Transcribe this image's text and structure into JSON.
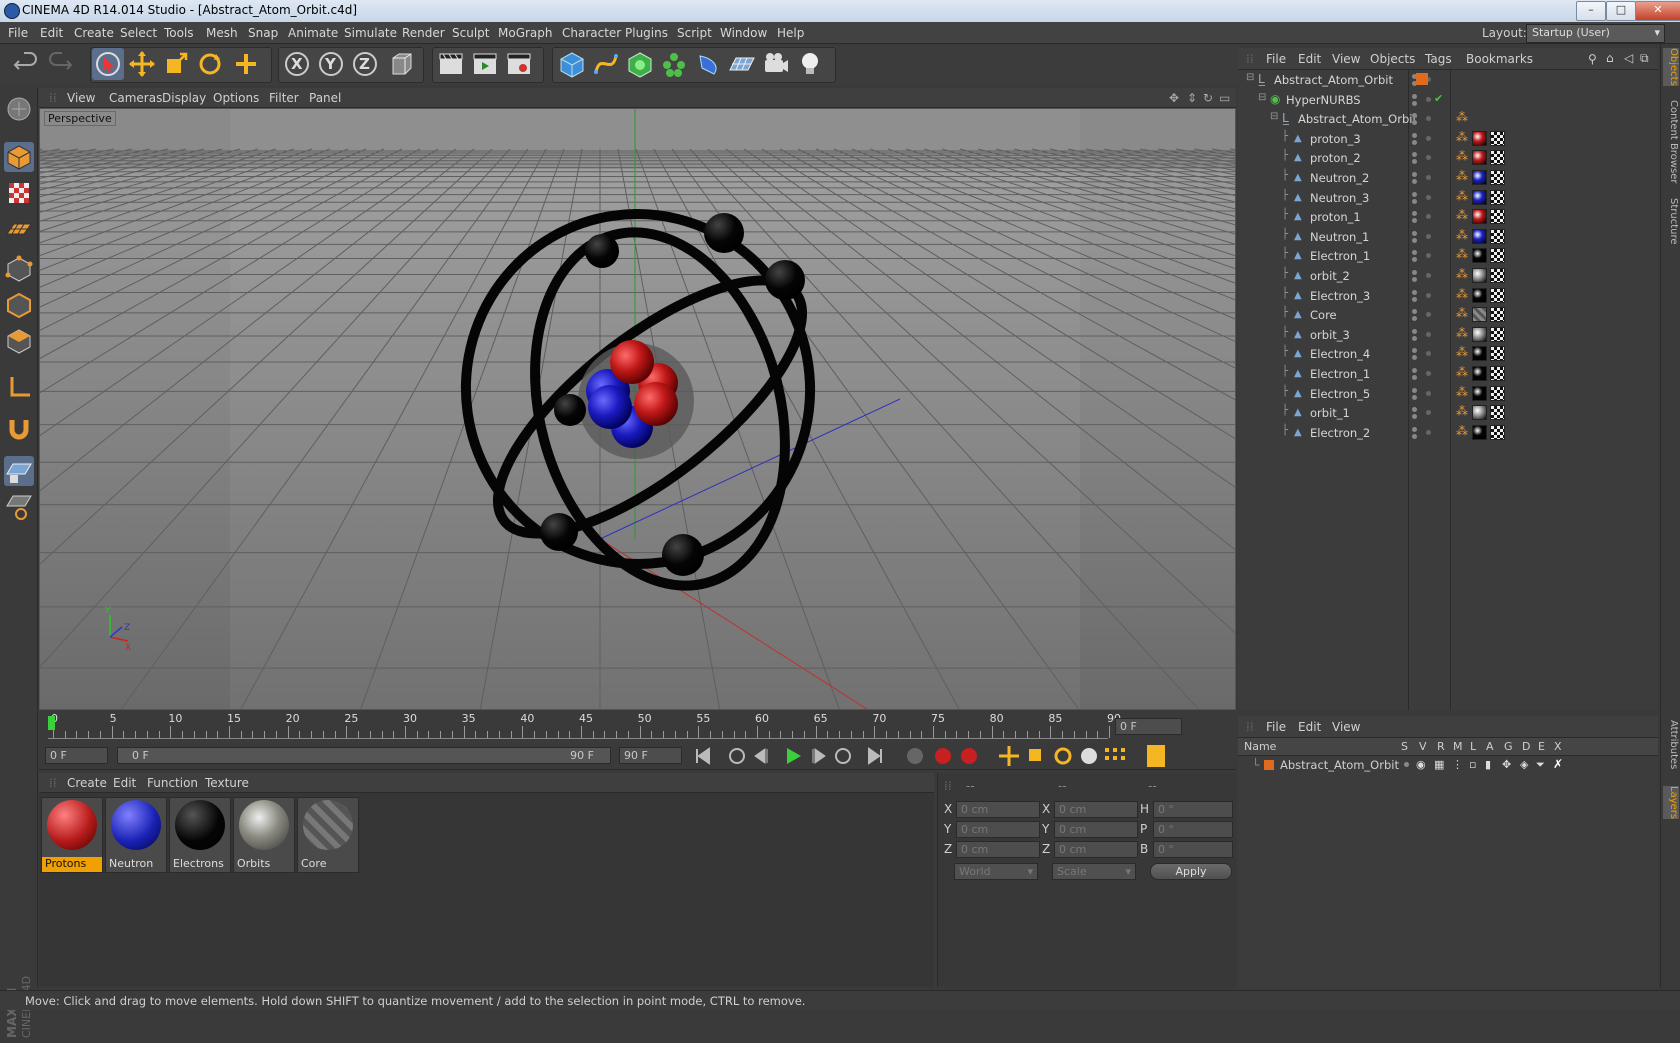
{
  "window": {
    "title": "CINEMA 4D R14.014 Studio - [Abstract_Atom_Orbit.c4d]",
    "min": "–",
    "max": "□",
    "close": "✕"
  },
  "menubar": {
    "items": [
      "File",
      "Edit",
      "Create",
      "Select",
      "Tools",
      "Mesh",
      "Snap",
      "Animate",
      "Simulate",
      "Render",
      "Sculpt",
      "MoGraph",
      "Character",
      "Plugins",
      "Script",
      "Window",
      "Help"
    ],
    "layout_label": "Layout:",
    "layout_value": "Startup (User)"
  },
  "viewport": {
    "menu": [
      "View",
      "Cameras",
      "Display",
      "Options",
      "Filter",
      "Panel"
    ],
    "label": "Perspective",
    "axis_y": "Y",
    "axis_x": "X",
    "axis_z": "Z"
  },
  "timeline": {
    "ticks": [
      "0",
      "5",
      "10",
      "15",
      "20",
      "25",
      "30",
      "35",
      "40",
      "45",
      "50",
      "55",
      "60",
      "65",
      "70",
      "75",
      "80",
      "85",
      "90"
    ],
    "current_frame": "0 F",
    "start_field": "0 F",
    "range_start": "0 F",
    "range_end": "90 F",
    "end_field": "90 F"
  },
  "materials": {
    "menu": [
      "Create",
      "Edit",
      "Function",
      "Texture"
    ],
    "items": [
      {
        "name": "Protons",
        "color": "#b51a1a",
        "selected": true
      },
      {
        "name": "Neutron",
        "color": "#1a22b5",
        "selected": false
      },
      {
        "name": "Electrons",
        "color": "#050505",
        "selected": false
      },
      {
        "name": "Orbits",
        "color": "#8a8a80",
        "selected": false
      },
      {
        "name": "Core",
        "color": "#6a6a6a",
        "selected": false
      }
    ]
  },
  "coords": {
    "headers": [
      "--",
      "--",
      "--"
    ],
    "rows": [
      {
        "a": "X",
        "av": "0 cm",
        "b": "X",
        "bv": "0 cm",
        "c": "H",
        "cv": "0 °"
      },
      {
        "a": "Y",
        "av": "0 cm",
        "b": "Y",
        "bv": "0 cm",
        "c": "P",
        "cv": "0 °"
      },
      {
        "a": "Z",
        "av": "0 cm",
        "b": "Z",
        "bv": "0 cm",
        "c": "B",
        "cv": "0 °"
      }
    ],
    "world": "World",
    "scale": "Scale",
    "apply": "Apply"
  },
  "objects": {
    "menu": [
      "File",
      "Edit",
      "View",
      "Objects",
      "Tags",
      "Bookmarks"
    ],
    "rows": [
      {
        "name": "Abstract_Atom_Orbit",
        "level": 0,
        "type": "null",
        "tag": "none"
      },
      {
        "name": "HyperNURBS",
        "level": 1,
        "type": "nurbs",
        "tag": "check"
      },
      {
        "name": "Abstract_Atom_Orbit",
        "level": 2,
        "type": "null",
        "tag": "phong"
      },
      {
        "name": "proton_3",
        "level": 3,
        "type": "poly",
        "tag": "red"
      },
      {
        "name": "proton_2",
        "level": 3,
        "type": "poly",
        "tag": "red"
      },
      {
        "name": "Neutron_2",
        "level": 3,
        "type": "poly",
        "tag": "blue"
      },
      {
        "name": "Neutron_3",
        "level": 3,
        "type": "poly",
        "tag": "blue"
      },
      {
        "name": "proton_1",
        "level": 3,
        "type": "poly",
        "tag": "red"
      },
      {
        "name": "Neutron_1",
        "level": 3,
        "type": "poly",
        "tag": "blue"
      },
      {
        "name": "Electron_1",
        "level": 3,
        "type": "poly",
        "tag": "black"
      },
      {
        "name": "orbit_2",
        "level": 3,
        "type": "poly",
        "tag": "chrome"
      },
      {
        "name": "Electron_3",
        "level": 3,
        "type": "poly",
        "tag": "black"
      },
      {
        "name": "Core",
        "level": 3,
        "type": "poly",
        "tag": "core"
      },
      {
        "name": "orbit_3",
        "level": 3,
        "type": "poly",
        "tag": "chrome"
      },
      {
        "name": "Electron_4",
        "level": 3,
        "type": "poly",
        "tag": "black"
      },
      {
        "name": "Electron_1",
        "level": 3,
        "type": "poly",
        "tag": "black"
      },
      {
        "name": "Electron_5",
        "level": 3,
        "type": "poly",
        "tag": "black"
      },
      {
        "name": "orbit_1",
        "level": 3,
        "type": "poly",
        "tag": "chrome"
      },
      {
        "name": "Electron_2",
        "level": 3,
        "type": "poly",
        "tag": "black"
      }
    ]
  },
  "layers": {
    "menu": [
      "File",
      "Edit",
      "View"
    ],
    "columns": [
      "Name",
      "S",
      "V",
      "R",
      "M",
      "L",
      "A",
      "G",
      "D",
      "E",
      "X"
    ],
    "rows": [
      {
        "name": "Abstract_Atom_Orbit",
        "color": "#e06a20"
      }
    ]
  },
  "right_tabs": [
    "Objects",
    "Content Browser",
    "Structure",
    "Attributes",
    "Layers"
  ],
  "branding": "MAXON CINEMA 4D",
  "status": "Move: Click and drag to move elements. Hold down SHIFT to quantize movement / add to the selection in point mode, CTRL to remove.",
  "colors": {
    "accent": "#e87c1e",
    "proton": "#b51a1a",
    "neutron": "#1a22b5",
    "electron": "#050505",
    "selection": "#f0a000"
  }
}
